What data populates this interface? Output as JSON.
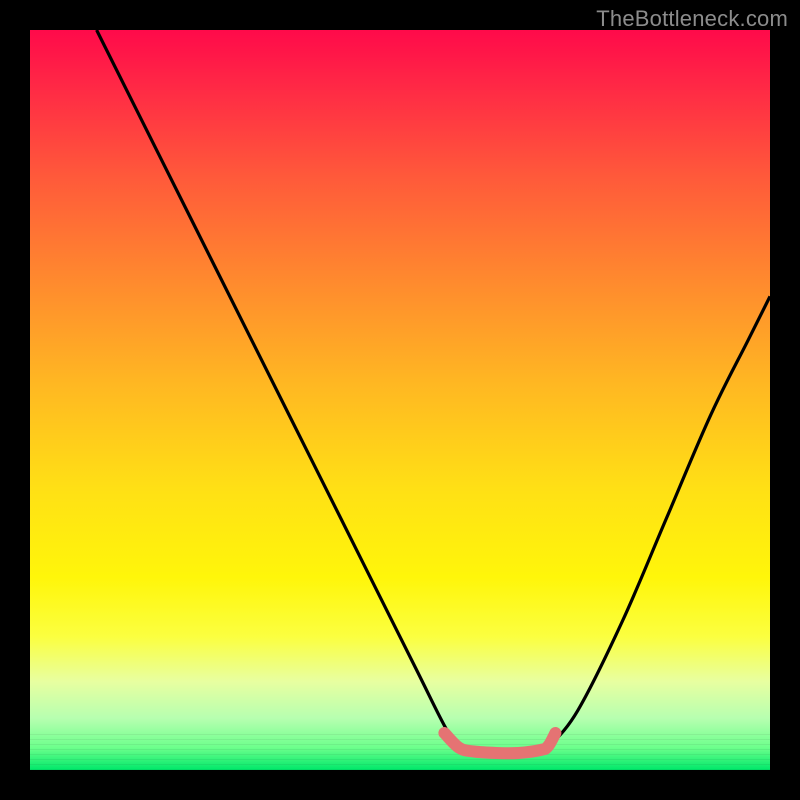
{
  "watermark": {
    "text": "TheBottleneck.com"
  },
  "colors": {
    "background": "#000000",
    "gradient_top": "#ff0a4a",
    "gradient_bottom": "#00e86a",
    "curve": "#000000",
    "highlight": "#e57373"
  },
  "chart_data": {
    "type": "line",
    "title": "",
    "xlabel": "",
    "ylabel": "",
    "xlim": [
      0,
      100
    ],
    "ylim": [
      0,
      100
    ],
    "legend": false,
    "grid": false,
    "notes": "Decorative bottleneck-style curve over a vertical heat gradient. No axis ticks or labels are visible; numeric values are estimated from geometry (0–100 normalized).",
    "series": [
      {
        "name": "left-curve",
        "x": [
          9,
          15,
          22,
          30,
          38,
          45,
          52,
          56,
          58
        ],
        "y": [
          100,
          88,
          74,
          58,
          42,
          28,
          14,
          6,
          3
        ]
      },
      {
        "name": "right-curve",
        "x": [
          70,
          74,
          80,
          86,
          92,
          97,
          100
        ],
        "y": [
          3,
          8,
          20,
          34,
          48,
          58,
          64
        ]
      },
      {
        "name": "highlight-segment",
        "x": [
          56,
          58,
          60,
          63,
          66,
          69,
          70,
          71
        ],
        "y": [
          5,
          3,
          2.5,
          2.3,
          2.3,
          2.7,
          3.2,
          5
        ]
      }
    ]
  }
}
